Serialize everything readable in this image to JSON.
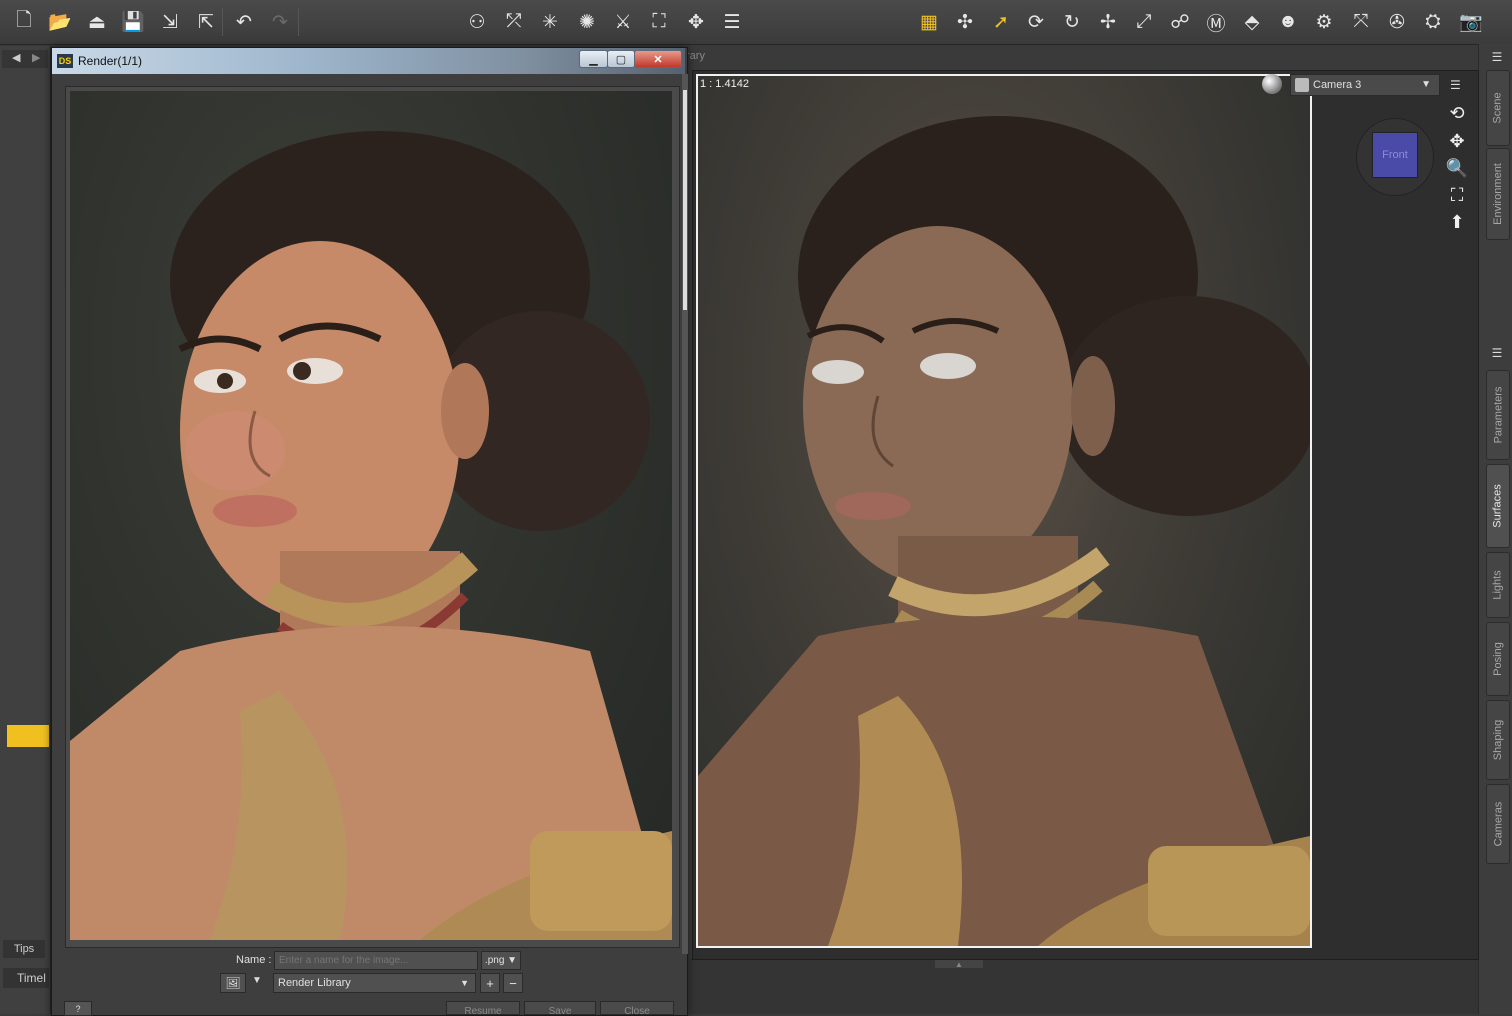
{
  "toolbar": {
    "file_icons": [
      "new-file-icon",
      "open-file-icon",
      "open-recent-icon",
      "save-icon",
      "import-icon",
      "export-icon",
      "undo-icon",
      "redo-icon"
    ],
    "scene_icons": [
      "create-figure-icon",
      "spotlight-icon",
      "point-light-icon",
      "distant-light-icon",
      "linear-light-icon",
      "camera-create-icon",
      "null-node-icon",
      "menu-strip-icon"
    ],
    "tool_icons": [
      "render-grid-icon",
      "universal-tool-icon",
      "node-select-icon",
      "rotate-tool-icon",
      "twist-tool-icon",
      "translate-tool-icon",
      "scale-tool-icon",
      "joint-editor-icon",
      "geometry-editor-icon",
      "surface-selection-icon",
      "figure-setup-icon",
      "render-settings-icon",
      "spot-render-icon",
      "iray-settings-icon",
      "render-icon"
    ]
  },
  "render_window": {
    "title": "Render(1/1)",
    "logo": "DS",
    "name_label": "Name :",
    "name_placeholder": "Enter a name for the image...",
    "extension": ".png ▼",
    "library": "Render Library",
    "add_label": "+",
    "remove_label": "−",
    "resume_label": "Resume",
    "save_label": "Save",
    "close_label": "Close",
    "help_label": "?"
  },
  "viewport": {
    "tab_label": "rary",
    "ratio": "1 : 1.4142",
    "camera": "Camera 3",
    "viewcube_face": "Front"
  },
  "side_tabs": {
    "top": [
      "Scene",
      "Environment"
    ],
    "bottom": [
      "Parameters",
      "Surfaces",
      "Lights",
      "Posing",
      "Shaping",
      "Cameras"
    ],
    "active": "Surfaces"
  },
  "left_dock": {
    "tips": "Tips",
    "timeline": "Timel"
  },
  "colors": {
    "accent_yellow": "#f0c020",
    "viewcube_face": "#4a4ba8",
    "close_button": "#c0392b"
  }
}
